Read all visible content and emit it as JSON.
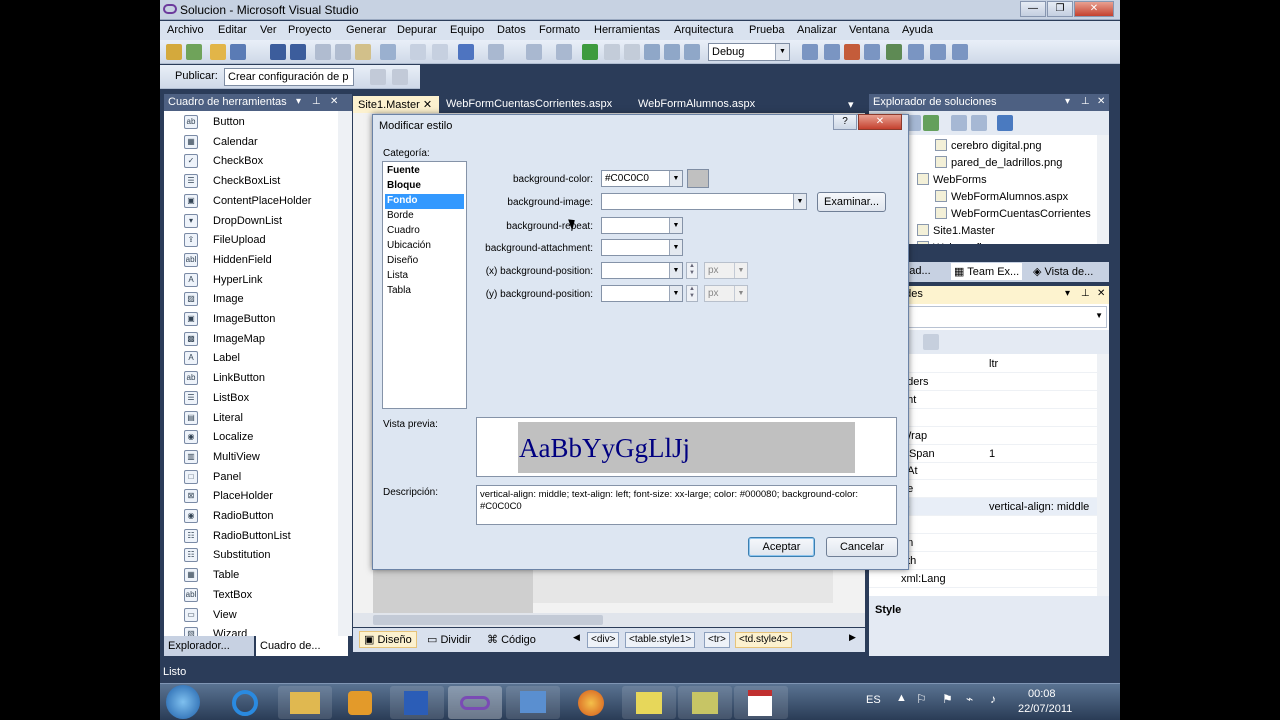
{
  "window": {
    "title": "Solucion - Microsoft Visual Studio"
  },
  "menu": [
    "Archivo",
    "Editar",
    "Ver",
    "Proyecto",
    "Generar",
    "Depurar",
    "Equipo",
    "Datos",
    "Formato",
    "Herramientas",
    "Arquitectura",
    "Prueba",
    "Analizar",
    "Ventana",
    "Ayuda"
  ],
  "toolbar": {
    "config": "Debug",
    "publish_label": "Publicar:",
    "publish_value": "Crear configuración de p"
  },
  "toolbox": {
    "title": "Cuadro de herramientas",
    "items": [
      {
        "label": "Button",
        "icon": "ab"
      },
      {
        "label": "Calendar",
        "icon": "▦"
      },
      {
        "label": "CheckBox",
        "icon": "✓"
      },
      {
        "label": "CheckBoxList",
        "icon": "☰"
      },
      {
        "label": "ContentPlaceHolder",
        "icon": "▣"
      },
      {
        "label": "DropDownList",
        "icon": "▾"
      },
      {
        "label": "FileUpload",
        "icon": "⇪"
      },
      {
        "label": "HiddenField",
        "icon": "abl"
      },
      {
        "label": "HyperLink",
        "icon": "A"
      },
      {
        "label": "Image",
        "icon": "▨"
      },
      {
        "label": "ImageButton",
        "icon": "▣"
      },
      {
        "label": "ImageMap",
        "icon": "▩"
      },
      {
        "label": "Label",
        "icon": "A"
      },
      {
        "label": "LinkButton",
        "icon": "ab"
      },
      {
        "label": "ListBox",
        "icon": "☰"
      },
      {
        "label": "Literal",
        "icon": "▤"
      },
      {
        "label": "Localize",
        "icon": "◉"
      },
      {
        "label": "MultiView",
        "icon": "▥"
      },
      {
        "label": "Panel",
        "icon": "□"
      },
      {
        "label": "PlaceHolder",
        "icon": "⊠"
      },
      {
        "label": "RadioButton",
        "icon": "◉"
      },
      {
        "label": "RadioButtonList",
        "icon": "☷"
      },
      {
        "label": "Substitution",
        "icon": "☷"
      },
      {
        "label": "Table",
        "icon": "▦"
      },
      {
        "label": "TextBox",
        "icon": "abl"
      },
      {
        "label": "View",
        "icon": "▭"
      },
      {
        "label": "Wizard",
        "icon": "▧"
      }
    ],
    "bottom_tabs": [
      "Explorador...",
      "Cuadro de..."
    ]
  },
  "doc_tabs": [
    "Site1.Master",
    "WebFormCuentasCorrientes.aspx",
    "WebFormAlumnos.aspx"
  ],
  "editor_bottom": {
    "views": [
      "Diseño",
      "Dividir",
      "Código"
    ],
    "breadcrumb": [
      "<div>",
      "<table.style1>",
      "<tr>",
      "<td.style4>"
    ]
  },
  "solution_explorer": {
    "title": "Explorador de soluciones",
    "items": [
      {
        "label": "cerebro digital.png",
        "indent": 2
      },
      {
        "label": "pared_de_ladrillos.png",
        "indent": 2
      },
      {
        "label": "WebForms",
        "indent": 1
      },
      {
        "label": "WebFormAlumnos.aspx",
        "indent": 2
      },
      {
        "label": "WebFormCuentasCorrientes",
        "indent": 2
      },
      {
        "label": "Site1.Master",
        "indent": 1
      },
      {
        "label": "Web.config",
        "indent": 1
      }
    ],
    "tabs": [
      "lorad...",
      "Team Ex...",
      "Vista de..."
    ]
  },
  "properties": {
    "title": "ades",
    "rows": [
      {
        "name": "",
        "value": "ltr"
      },
      {
        "name": "aders",
        "value": ""
      },
      {
        "name": "ght",
        "value": ""
      },
      {
        "name": "g",
        "value": ""
      },
      {
        "name": "Wrap",
        "value": ""
      },
      {
        "name": "wSpan",
        "value": "1"
      },
      {
        "name": "nAt",
        "value": ""
      },
      {
        "name": "pe",
        "value": ""
      },
      {
        "name": "le",
        "value": "vertical-align: middle"
      },
      {
        "name": "e",
        "value": ""
      },
      {
        "name": "gn",
        "value": ""
      },
      {
        "name": "dth",
        "value": ""
      },
      {
        "name": "xml:Lang",
        "value": ""
      }
    ],
    "description_title": "Style"
  },
  "status": "Listo",
  "dialog": {
    "title": "Modificar estilo",
    "category_label": "Categoría:",
    "categories": [
      {
        "label": "Fuente",
        "bold": true
      },
      {
        "label": "Bloque",
        "bold": true
      },
      {
        "label": "Fondo",
        "bold": true,
        "selected": true
      },
      {
        "label": "Borde"
      },
      {
        "label": "Cuadro"
      },
      {
        "label": "Ubicación"
      },
      {
        "label": "Diseño"
      },
      {
        "label": "Lista"
      },
      {
        "label": "Tabla"
      }
    ],
    "fields": {
      "bg_color_label": "background-color:",
      "bg_color_value": "#C0C0C0",
      "bg_image_label": "background-image:",
      "browse": "Examinar...",
      "bg_repeat_label": "background-repeat:",
      "bg_attach_label": "background-attachment:",
      "bg_posx_label": "(x) background-position:",
      "bg_posy_label": "(y) background-position:",
      "unit": "px"
    },
    "preview_label": "Vista previa:",
    "preview_text": "AaBbYyGgLlJj",
    "description_label": "Descripción:",
    "description_text": "vertical-align: middle; text-align: left; font-size: xx-large; color: #000080; background-color: #C0C0C0",
    "ok": "Aceptar",
    "cancel": "Cancelar"
  },
  "tray": {
    "lang": "ES",
    "time": "00:08",
    "date": "22/07/2011"
  },
  "colors": {
    "swatch": "#C0C0C0",
    "preview_text": "#000080",
    "selection": "#3399ff"
  }
}
